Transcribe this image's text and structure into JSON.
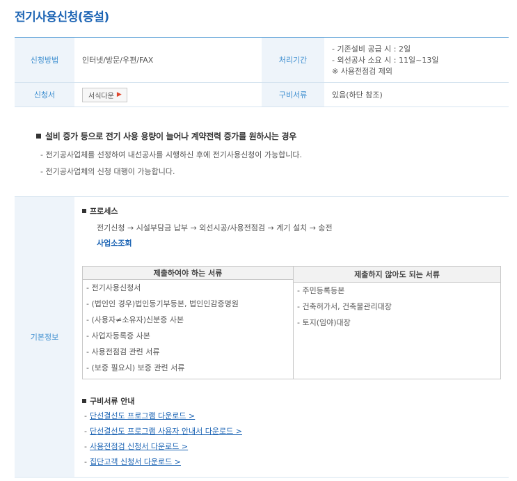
{
  "page_title": "전기사용신청(증설)",
  "info": {
    "method_label": "신청방법",
    "method_value": "인터넷/방문/우편/FAX",
    "period_label": "처리기간",
    "period_lines": [
      "- 기존설비 공급 시 : 2일",
      "- 외선공사 소요 시 : 11일~13일",
      "※ 사용전점검 제외"
    ],
    "form_label": "신청서",
    "form_button": "서식다운",
    "docs_label": "구비서류",
    "docs_value": "있음(하단 참조)"
  },
  "notice": {
    "heading": "설비 증가 등으로 전기 사용 용량이 늘어나 계약전력 증가를 원하시는 경우",
    "lines": [
      "- 전기공사업체를 선정하여 내선공사를 시행하신 후에 전기사용신청이 가능합니다.",
      "- 전기공사업체의 신청 대행이 가능합니다."
    ]
  },
  "basic": {
    "label": "기본정보",
    "process_heading": "프로세스",
    "process_text": "전기신청 → 시설부담금 납부 → 외선시공/사용전점검 → 계기 설치 → 송전",
    "process_link": "사업소조회",
    "doc_table": {
      "col1_header": "제출하여야 하는 서류",
      "col2_header": "제출하지 않아도 되는 서류",
      "col1_items": [
        "- 전기사용신청서",
        "- (법인인 경우)법인등기부등본, 법인인감증명원",
        "- (사용자≠소유자)신분증 사본",
        "- 사업자등록증 사본",
        "- 사용전점검 관련 서류",
        "- (보증 필요시) 보증 관련 서류"
      ],
      "col2_items": [
        "- 주민등록등본",
        "- 건축허가서, 건축물관리대장",
        "- 토지(임야)대장"
      ]
    },
    "guide_heading": "구비서류 안내",
    "guide_links": [
      "단선결선도 프로그램 다운로드 >",
      "단선결선도 프로그램 사용자 안내서 다운로드 >",
      "사용전점검 신청서 다운로드 >",
      "집단고객 신청서 다운로드 >"
    ]
  },
  "icons": {
    "form_button_arrow": "chevron-right-icon",
    "bullet": "square-bullet-icon"
  },
  "colors": {
    "title_blue": "#1c64b4",
    "label_blue": "#3f8fd0",
    "label_bg": "#eef4fa",
    "arrow_red": "#e0452c"
  }
}
